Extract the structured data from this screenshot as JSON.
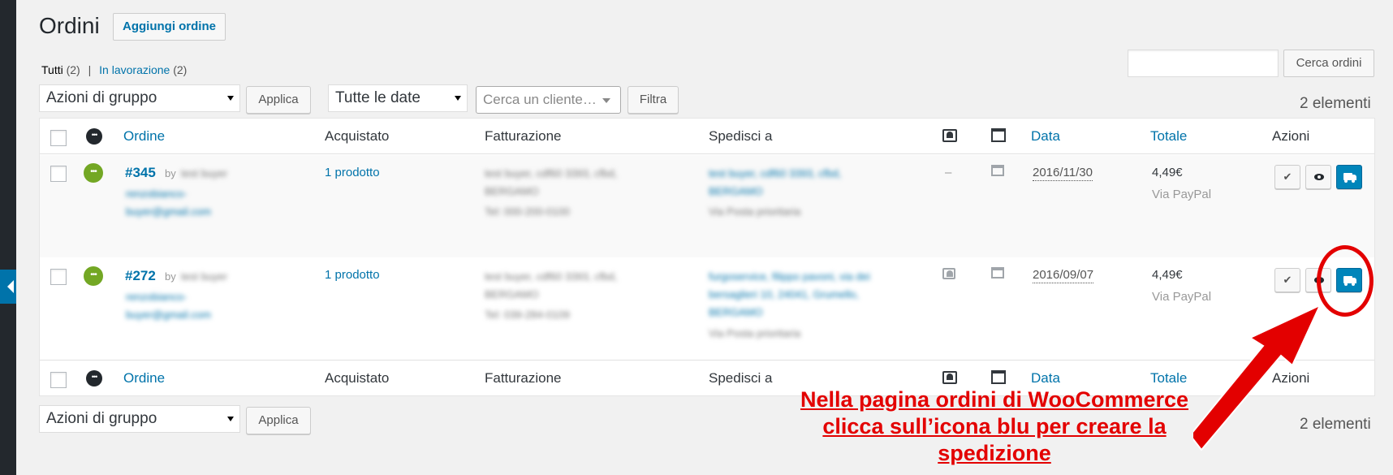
{
  "page": {
    "title": "Ordini",
    "add_button": "Aggiungi ordine"
  },
  "filters": {
    "all_label": "Tutti",
    "all_count": "(2)",
    "separator": "|",
    "processing_label": "In lavorazione",
    "processing_count": "(2)"
  },
  "search": {
    "input_value": "",
    "button": "Cerca ordini"
  },
  "toolbar_top": {
    "bulk_actions": "Azioni di gruppo",
    "apply": "Applica",
    "dates": "Tutte le date",
    "customer_placeholder": "Cerca un cliente…",
    "filter": "Filtra",
    "count": "2 elementi"
  },
  "toolbar_bottom": {
    "bulk_actions": "Azioni di gruppo",
    "apply": "Applica",
    "count": "2 elementi"
  },
  "columns": {
    "order": "Ordine",
    "purchased": "Acquistato",
    "billing": "Fatturazione",
    "ship_to": "Spedisci a",
    "date": "Data",
    "total": "Totale",
    "actions": "Azioni"
  },
  "orders": [
    {
      "number": "#345",
      "by": "by",
      "customer": "test buyer",
      "email_line1": "renzobianco-",
      "email_line2": "buyer@gmail.com",
      "purchased": "1 prodotto",
      "billing_line1": "test buyer, cdf60 3393, cfbd,",
      "billing_line2": "BERGAMO",
      "billing_line3": "Tel: 000-200-0100",
      "ship_line1": "test buyer, cdf60 3393, cfbd,",
      "ship_line2": "BERGAMO",
      "ship_line3": "",
      "ship_method": "Via Posta prioritaria",
      "notes": "–",
      "date": "2016/11/30",
      "total": "4,49€",
      "payment": "Via PayPal"
    },
    {
      "number": "#272",
      "by": "by",
      "customer": "test buyer",
      "email_line1": "renzobianco-",
      "email_line2": "buyer@gmail.com",
      "purchased": "1 prodotto",
      "billing_line1": "test buyer, cdf60 3393, cfbd,",
      "billing_line2": "BERGAMO",
      "billing_line3": "Tel: 039-284-0109",
      "ship_line1": "furgoservice, filippo pavoni, via dei",
      "ship_line2": "bersaglieri 10, 24041, Grumello,",
      "ship_line3": "BERGAMO",
      "ship_method": "Via Posta prioritaria",
      "notes": "",
      "date": "2016/09/07",
      "total": "4,49€",
      "payment": "Via PayPal"
    }
  ],
  "annotation": {
    "line1": "Nella pagina ordini di WooCommerce",
    "line2": "clicca sull’icona blu per creare la",
    "line3": "spedizione",
    "color": "#e30000"
  },
  "icons": {
    "status": "more-dots-icon",
    "complete": "check-icon",
    "view": "eye-icon",
    "ship": "truck-icon"
  },
  "colors": {
    "link": "#0073aa",
    "status_processing": "#73a724",
    "ship_button": "#0085ba"
  }
}
